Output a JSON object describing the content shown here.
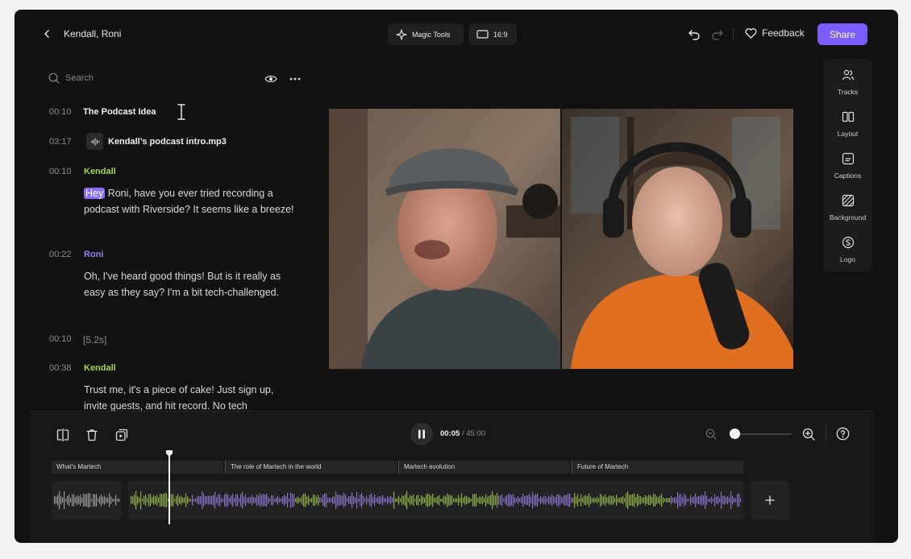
{
  "header": {
    "title": "Kendall, Roni",
    "magic_tools_label": "Magic Tools",
    "aspect_label": "16:9",
    "feedback_label": "Feedback",
    "share_label": "Share"
  },
  "search": {
    "placeholder": "Search"
  },
  "transcript": {
    "chapter": {
      "time": "00:10",
      "title": "The Podcast Idea"
    },
    "audio": {
      "time": "03:17",
      "file": "Kendall’s podcast intro.mp3"
    },
    "entries": [
      {
        "time": "00:10",
        "speaker": "Kendall",
        "highlight": "Hey",
        "text": " Roni, have you ever tried recording a podcast with Riverside? It seems like a breeze!"
      },
      {
        "time": "00:22",
        "speaker": "Roni",
        "text": "Oh, I've heard good things! But is it really as easy as they say? I'm a bit tech-challenged."
      },
      {
        "time": "00:10",
        "gap": "[5.2s]"
      },
      {
        "time": "00:38",
        "speaker": "Kendall",
        "text": "Trust me, it's a piece of cake! Just sign up, invite guests, and hit record. No tech"
      }
    ]
  },
  "right_panel": {
    "items": [
      {
        "label": "Tracks",
        "icon": "tracks-icon"
      },
      {
        "label": "Layout",
        "icon": "layout-icon"
      },
      {
        "label": "Captions",
        "icon": "captions-icon"
      },
      {
        "label": "Background",
        "icon": "background-icon"
      },
      {
        "label": "Logo",
        "icon": "logo-icon"
      }
    ]
  },
  "playback": {
    "current": "00:05",
    "separator": " / ",
    "total": "45:00",
    "zoom_level": 0.0
  },
  "timeline": {
    "chapters": [
      "What's Martech",
      "The role of Martech in the world",
      "Martech evolution",
      "Future of Martech"
    ]
  },
  "colors": {
    "accent": "#7c5cff",
    "kendall": "#a6d35a",
    "roni": "#9b7cf5",
    "wave_green": "#8fb04a",
    "wave_purple": "#8a72c9",
    "wave_gray": "#9a9a9a"
  }
}
